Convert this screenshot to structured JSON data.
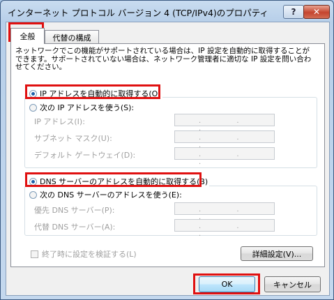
{
  "window": {
    "title": "インターネット プロトコル バージョン 4 (TCP/IPv4)のプロパティ",
    "help_label": "?",
    "close_label": "✕"
  },
  "tabs": [
    {
      "label": "全般",
      "selected": true
    },
    {
      "label": "代替の構成",
      "selected": false
    }
  ],
  "description": "ネットワークでこの機能がサポートされている場合は、IP 設定を自動的に取得することができます。サポートされていない場合は、ネットワーク管理者に適切な IP 設定を問い合わせてください。",
  "ip_section": {
    "auto_label": "IP アドレスを自動的に取得する(O)",
    "auto_selected": true,
    "manual_label": "次の IP アドレスを使う(S):",
    "fields": [
      {
        "label": "IP アドレス(I):",
        "value": ". . ."
      },
      {
        "label": "サブネット マスク(U):",
        "value": ". . ."
      },
      {
        "label": "デフォルト ゲートウェイ(D):",
        "value": ". . ."
      }
    ]
  },
  "dns_section": {
    "auto_label": "DNS サーバーのアドレスを自動的に取得する(B)",
    "auto_selected": true,
    "manual_label": "次の DNS サーバーのアドレスを使う(E):",
    "fields": [
      {
        "label": "優先 DNS サーバー(P):",
        "value": ". . ."
      },
      {
        "label": "代替 DNS サーバー(A):",
        "value": ". . ."
      }
    ]
  },
  "validate_checkbox": {
    "label": "終了時に設定を検証する(L)",
    "checked": false
  },
  "advanced_button": "詳細設定(V)...",
  "ok_button": "OK",
  "cancel_button": "キャンセル",
  "highlight_color": "#e01010"
}
